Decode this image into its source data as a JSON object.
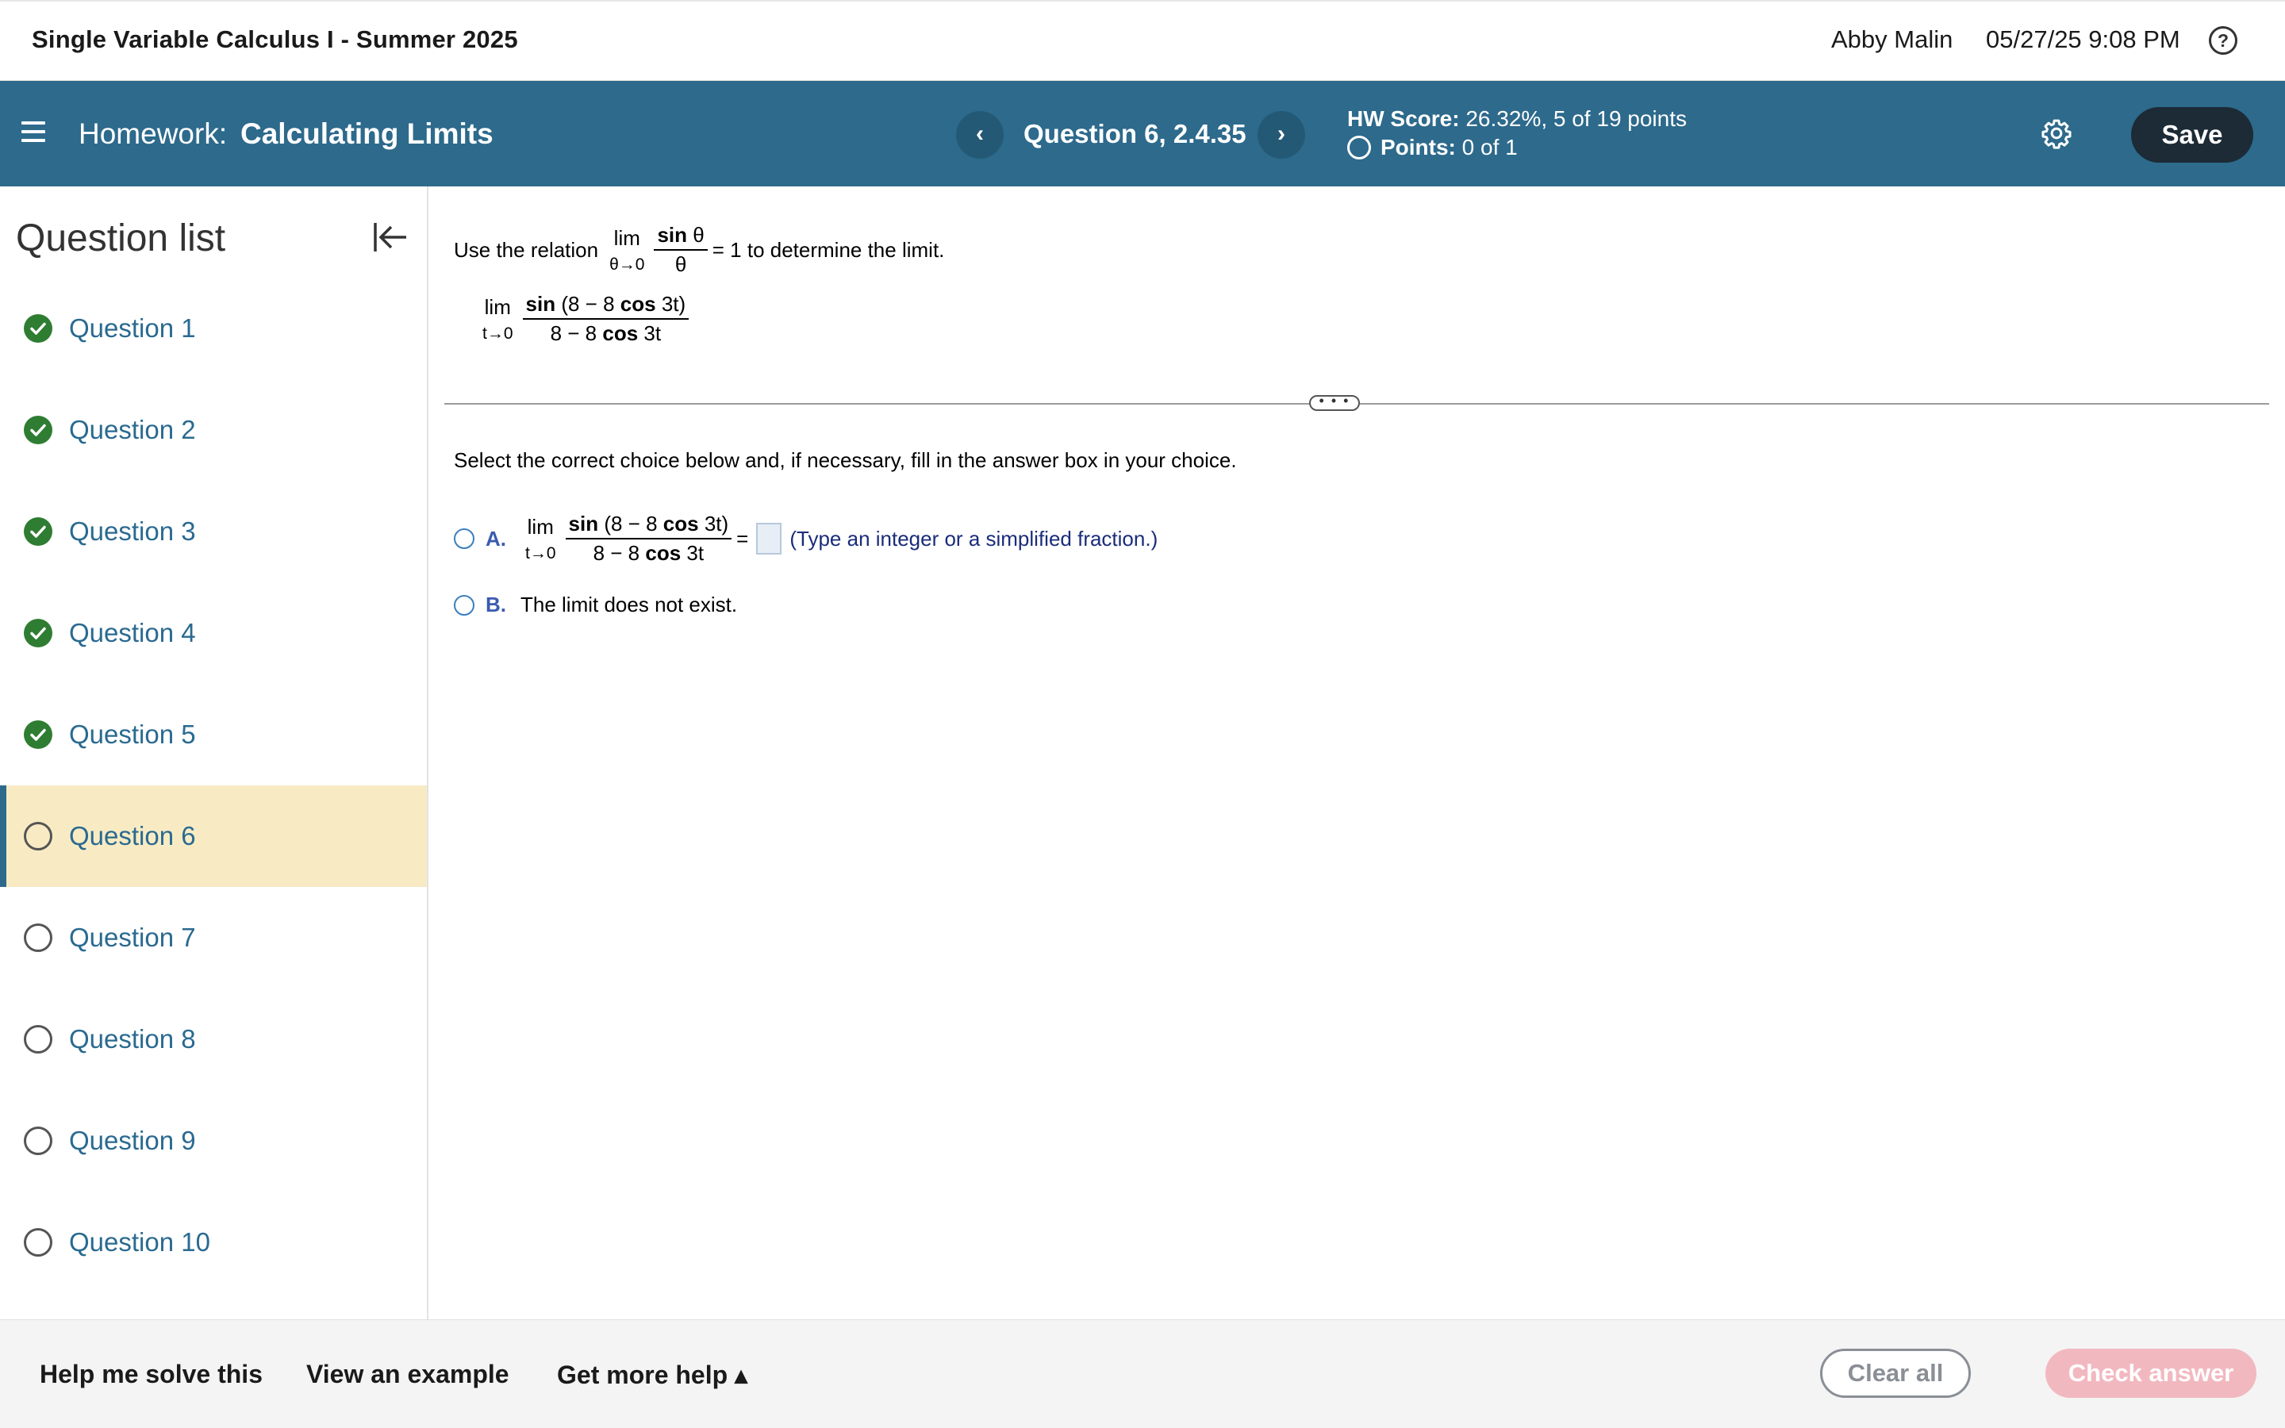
{
  "topbar": {
    "course_title": "Single Variable Calculus I - Summer 2025",
    "user_name": "Abby Malin",
    "datetime": "05/27/25 9:08 PM",
    "help_icon": "?"
  },
  "header": {
    "homework_prefix": "Homework:",
    "homework_name": "Calculating Limits",
    "prev_icon": "‹",
    "next_icon": "›",
    "question_label": "Question 6, 2.4.35",
    "score_label": "HW Score:",
    "score_value": "26.32%, 5 of 19 points",
    "points_label": "Points:",
    "points_value": "0 of 1",
    "save_label": "Save",
    "color": "#2d6a8c"
  },
  "sidebar": {
    "title": "Question list",
    "items": [
      {
        "label": "Question 1",
        "status": "done"
      },
      {
        "label": "Question 2",
        "status": "done"
      },
      {
        "label": "Question 3",
        "status": "done"
      },
      {
        "label": "Question 4",
        "status": "done"
      },
      {
        "label": "Question 5",
        "status": "done"
      },
      {
        "label": "Question 6",
        "status": "current"
      },
      {
        "label": "Question 7",
        "status": "open"
      },
      {
        "label": "Question 8",
        "status": "open"
      },
      {
        "label": "Question 9",
        "status": "open"
      },
      {
        "label": "Question 10",
        "status": "open"
      }
    ]
  },
  "question": {
    "prompt_pre": "Use the relation",
    "lim": "lim",
    "rel_sub": "θ→0",
    "rel_num_bold": "sin",
    "rel_num_var": "θ",
    "rel_den": "θ",
    "prompt_post": "= 1 to determine the limit.",
    "expr_sub": "t→0",
    "expr_num_a": "sin",
    "expr_num_b": "(8 − 8",
    "expr_num_c": "cos",
    "expr_num_d": "3t)",
    "expr_den_a": "8 − 8",
    "expr_den_b": "cos",
    "expr_den_c": "3t",
    "handle": "• • •",
    "instruction": "Select the correct choice below and, if necessary, fill in the answer box in your choice.",
    "choice_a_letter": "A.",
    "equals": "=",
    "choice_a_hint": "(Type an integer or a simplified fraction.)",
    "choice_b_letter": "B.",
    "choice_b_text": "The limit does not exist."
  },
  "bottom": {
    "help_solve": "Help me solve this",
    "view_example": "View an example",
    "more_help": "Get more help ▴",
    "clear_all": "Clear all",
    "check_answer": "Check answer"
  }
}
